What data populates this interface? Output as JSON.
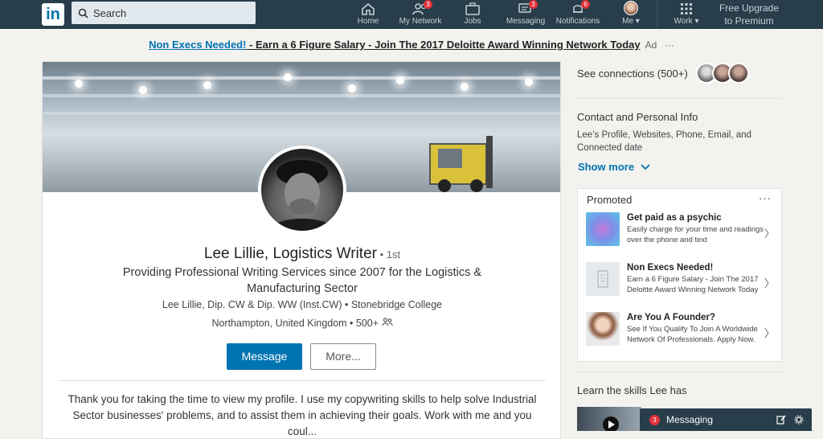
{
  "nav": {
    "logo": "in",
    "search_placeholder": "Search",
    "items": [
      {
        "label": "Home",
        "badge": ""
      },
      {
        "label": "My Network",
        "badge": "3"
      },
      {
        "label": "Jobs",
        "badge": ""
      },
      {
        "label": "Messaging",
        "badge": "3"
      },
      {
        "label": "Notifications",
        "badge": "6"
      },
      {
        "label": "Me ▾",
        "badge": ""
      },
      {
        "label": "Work ▾",
        "badge": ""
      }
    ],
    "premium_line1": "Free Upgrade",
    "premium_line2": "to Premium"
  },
  "ad": {
    "link": "Non Execs Needed!",
    "body": " - Earn a 6 Figure Salary - Join The 2017 Deloitte Award Winning Network Today",
    "tag": "Ad",
    "menu": "···"
  },
  "profile": {
    "name": "Lee Lillie, Logistics Writer",
    "degree": " • 1st",
    "headline": "Providing Professional Writing Services since 2007 for the Logistics & Manufacturing Sector",
    "education": "Lee Lillie, Dip. CW & Dip. WW (Inst.CW)  •  Stonebridge College",
    "location": "Northampton, United Kingdom  •  500+",
    "message_label": "Message",
    "more_label": "More...",
    "summary": "Thank you for taking the time to view my profile. I use my copywriting skills to help solve Industrial Sector businesses' problems, and to assist them in achieving their goals. Work with me and you coul..."
  },
  "sidebar": {
    "see_connections": "See connections (500+)",
    "contact_title": "Contact and Personal Info",
    "contact_body": "Lee’s Profile, Websites, Phone, Email, and Connected date",
    "show_more": "Show more",
    "promoted": {
      "title": "Promoted",
      "menu": "···",
      "items": [
        {
          "title": "Get paid as a psychic",
          "body": "Easily charge for your time and readings over the phone and text"
        },
        {
          "title": "Non Execs Needed!",
          "body": "Earn a 6 Figure Salary - Join The 2017 Deloitte Award Winning Network Today"
        },
        {
          "title": "Are You A Founder?",
          "body": "See If You Qualify To Join A Worldwide Network Of Professionals. Apply Now."
        }
      ]
    },
    "learn_title": "Learn the skills Lee has"
  },
  "messaging": {
    "badge": "3",
    "label": "Messaging"
  },
  "colors": {
    "nav_bg": "#283e4a",
    "brand_blue": "#0073b1",
    "badge_red": "#e0313b"
  }
}
